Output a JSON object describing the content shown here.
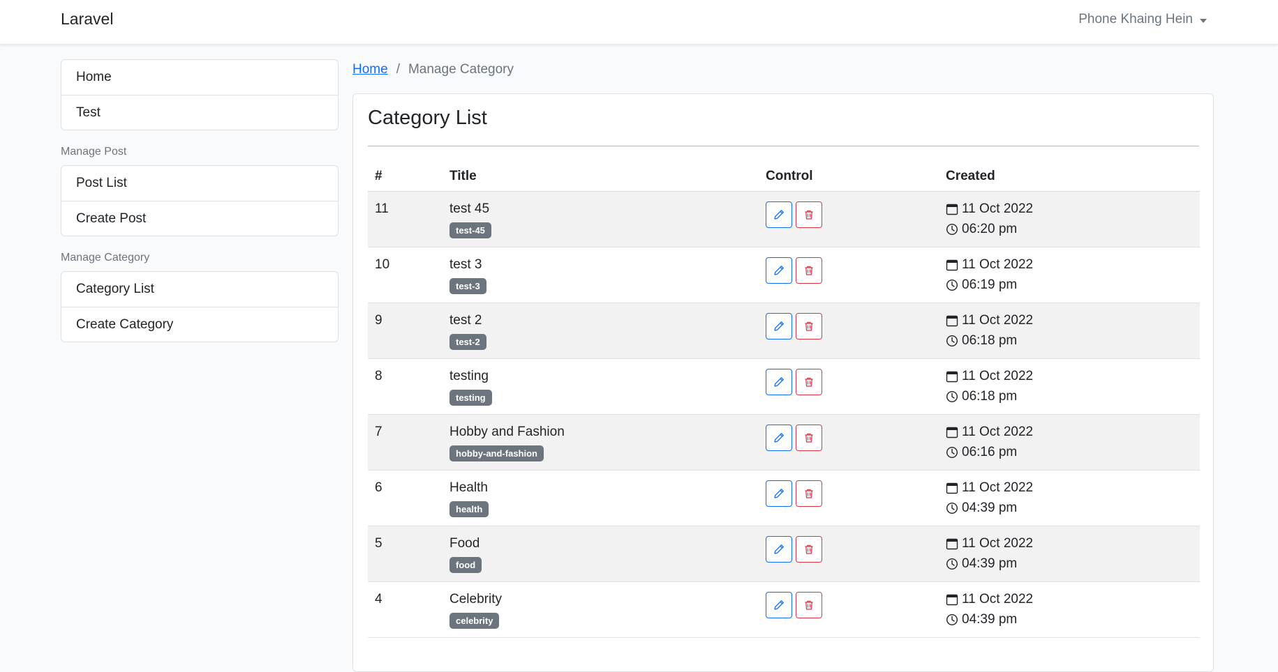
{
  "navbar": {
    "brand": "Laravel",
    "user_name": "Phone Khaing Hein"
  },
  "sidebar": {
    "top_items": [
      {
        "label": "Home"
      },
      {
        "label": "Test"
      }
    ],
    "sections": [
      {
        "heading": "Manage Post",
        "items": [
          {
            "label": "Post List"
          },
          {
            "label": "Create Post"
          }
        ]
      },
      {
        "heading": "Manage Category",
        "items": [
          {
            "label": "Category List"
          },
          {
            "label": "Create Category"
          }
        ]
      }
    ]
  },
  "breadcrumb": {
    "home": "Home",
    "separator": "/",
    "current": "Manage Category"
  },
  "card": {
    "title": "Category List"
  },
  "table": {
    "headers": {
      "num": "#",
      "title": "Title",
      "control": "Control",
      "created": "Created"
    },
    "rows": [
      {
        "id": "11",
        "title": "test 45",
        "slug": "test-45",
        "date": "11 Oct 2022",
        "time": "06:20 pm"
      },
      {
        "id": "10",
        "title": "test 3",
        "slug": "test-3",
        "date": "11 Oct 2022",
        "time": "06:19 pm"
      },
      {
        "id": "9",
        "title": "test 2",
        "slug": "test-2",
        "date": "11 Oct 2022",
        "time": "06:18 pm"
      },
      {
        "id": "8",
        "title": "testing",
        "slug": "testing",
        "date": "11 Oct 2022",
        "time": "06:18 pm"
      },
      {
        "id": "7",
        "title": "Hobby and Fashion",
        "slug": "hobby-and-fashion",
        "date": "11 Oct 2022",
        "time": "06:16 pm"
      },
      {
        "id": "6",
        "title": "Health",
        "slug": "health",
        "date": "11 Oct 2022",
        "time": "04:39 pm"
      },
      {
        "id": "5",
        "title": "Food",
        "slug": "food",
        "date": "11 Oct 2022",
        "time": "04:39 pm"
      },
      {
        "id": "4",
        "title": "Celebrity",
        "slug": "celebrity",
        "date": "11 Oct 2022",
        "time": "04:39 pm"
      }
    ]
  },
  "icons": {
    "edit": "pencil-icon",
    "delete": "trash-icon",
    "date": "calendar-icon",
    "time": "clock-icon"
  },
  "colors": {
    "primary": "#0d6efd",
    "danger": "#dc3545",
    "badge": "#6c757d"
  }
}
